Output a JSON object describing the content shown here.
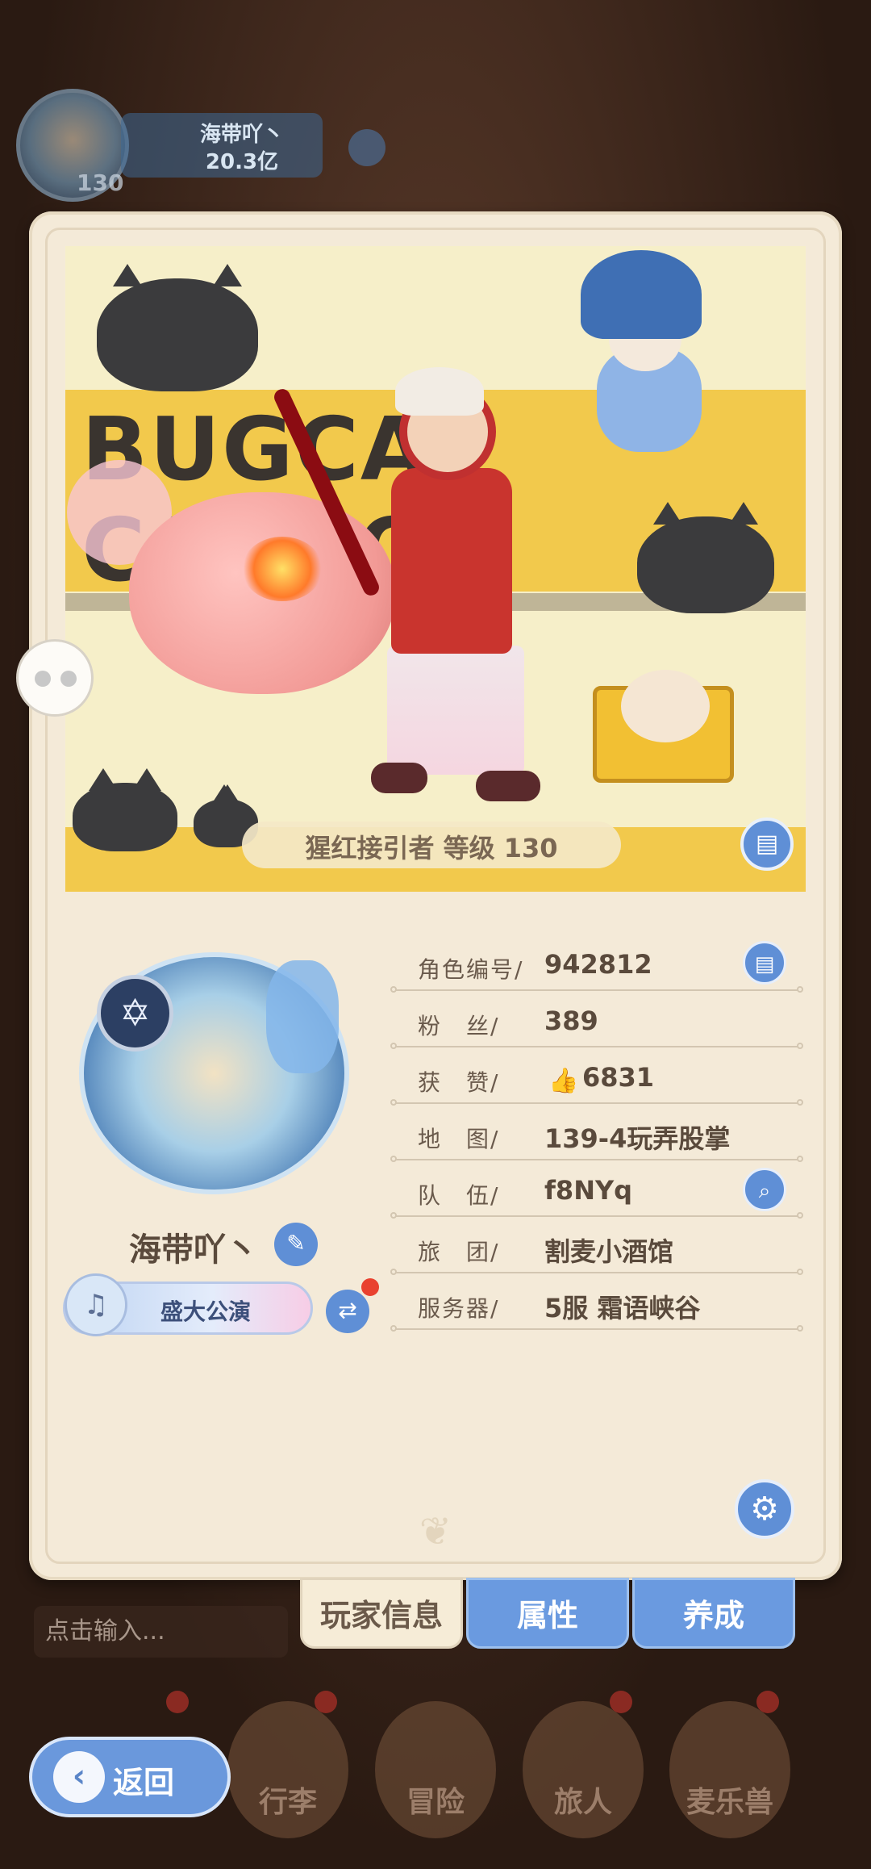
{
  "hud": {
    "player_name": "海带吖丶",
    "power": "20.3亿",
    "level": "130"
  },
  "banner": {
    "backdrop_text": "BUGCAT CAPOO",
    "level_text": "猩红接引者 等级 130"
  },
  "profile": {
    "name": "海带吖丶",
    "title_plate": "盛大公演",
    "rows": [
      {
        "label": "角色编号/",
        "value": "942812"
      },
      {
        "label": "粉　丝/",
        "value": "389"
      },
      {
        "label": "获　赞/",
        "value": "6831"
      },
      {
        "label": "地　图/",
        "value": "139-4玩弄股掌"
      },
      {
        "label": "队　伍/",
        "value": "f8NYq"
      },
      {
        "label": "旅　团/",
        "value": "割麦小酒馆"
      },
      {
        "label": "服务器/",
        "value": "5服  霜语峡谷"
      }
    ]
  },
  "tabs": [
    "玩家信息",
    "属性",
    "养成"
  ],
  "chat": {
    "placeholder": "点击输入..."
  },
  "nav": [
    "行李",
    "冒险",
    "旅人",
    "麦乐兽"
  ],
  "back": {
    "label": "返回"
  },
  "icons": {
    "edit": "pencil-icon",
    "swap": "swap-icon",
    "copy": "copy-icon",
    "search": "search-icon",
    "settings": "gear-icon",
    "photo": "photo-card-icon",
    "chat": "chat-bubble-icon",
    "likes": "thumbs-up-icon",
    "back": "chevron-left-icon"
  },
  "colors": {
    "accent_blue": "#5f8fd6",
    "card_bg": "#f4ead8",
    "banner_yellow": "#f2c94c",
    "notify_red": "#e9412f"
  }
}
